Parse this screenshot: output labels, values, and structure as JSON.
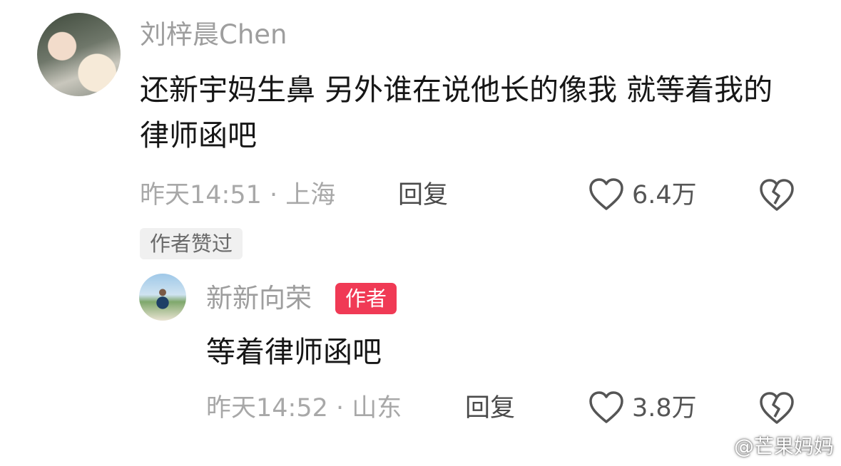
{
  "comment": {
    "username": "刘梓晨Chen",
    "text": "还新宇妈生鼻 另外谁在说他长的像我 就等着我的律师函吧",
    "time": "昨天14:51",
    "location": "上海",
    "reply_label": "回复",
    "like_count": "6.4万",
    "author_liked": "作者赞过"
  },
  "reply": {
    "username": "新新向荣",
    "author_badge": "作者",
    "text": "等着律师函吧",
    "time": "昨天14:52",
    "location": "山东",
    "reply_label": "回复",
    "like_count": "3.8万"
  },
  "watermark": {
    "text": "@芒果妈妈",
    "icon": "weibo-logo-icon"
  },
  "icons": {
    "like": "heart-outline-icon",
    "dislike": "broken-heart-icon"
  },
  "colors": {
    "author_badge": "#f03a55",
    "meta_gray": "#a8a8a8"
  }
}
